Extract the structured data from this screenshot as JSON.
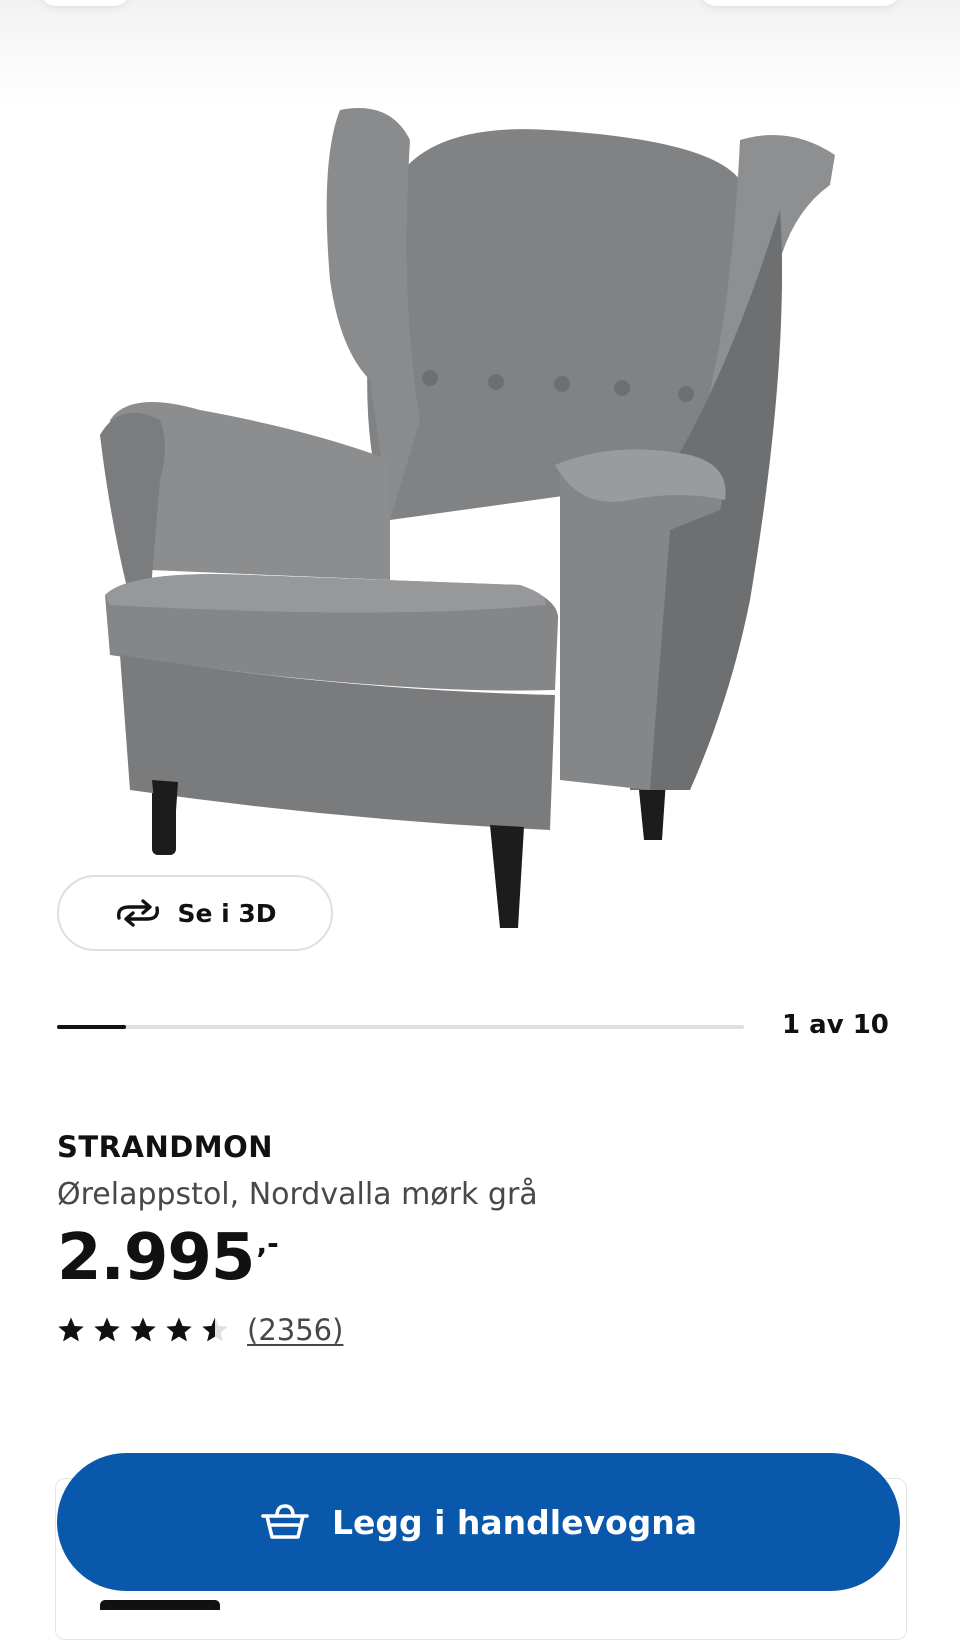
{
  "gallery": {
    "view_3d_label": "Se i 3D",
    "counter": "1 av 10",
    "progress": 0.1
  },
  "product": {
    "name": "STRANDMON",
    "description": "Ørelappstol, Nordvalla mørk grå",
    "price": "2.995",
    "price_suffix": ",-",
    "rating": 4.5,
    "rating_max": 5,
    "review_count": "(2356)"
  },
  "actions": {
    "add_to_cart_label": "Legg i handlevogna"
  },
  "colors": {
    "primary_button": "#0a58ab",
    "text": "#111111",
    "muted_text": "#484848",
    "chair_fabric": "#7a7b7d",
    "chair_legs": "#1c1c1c"
  },
  "icons": {
    "view_3d": "rotate-3d-icon",
    "cart": "shopping-basket-icon",
    "star": "star-icon"
  }
}
